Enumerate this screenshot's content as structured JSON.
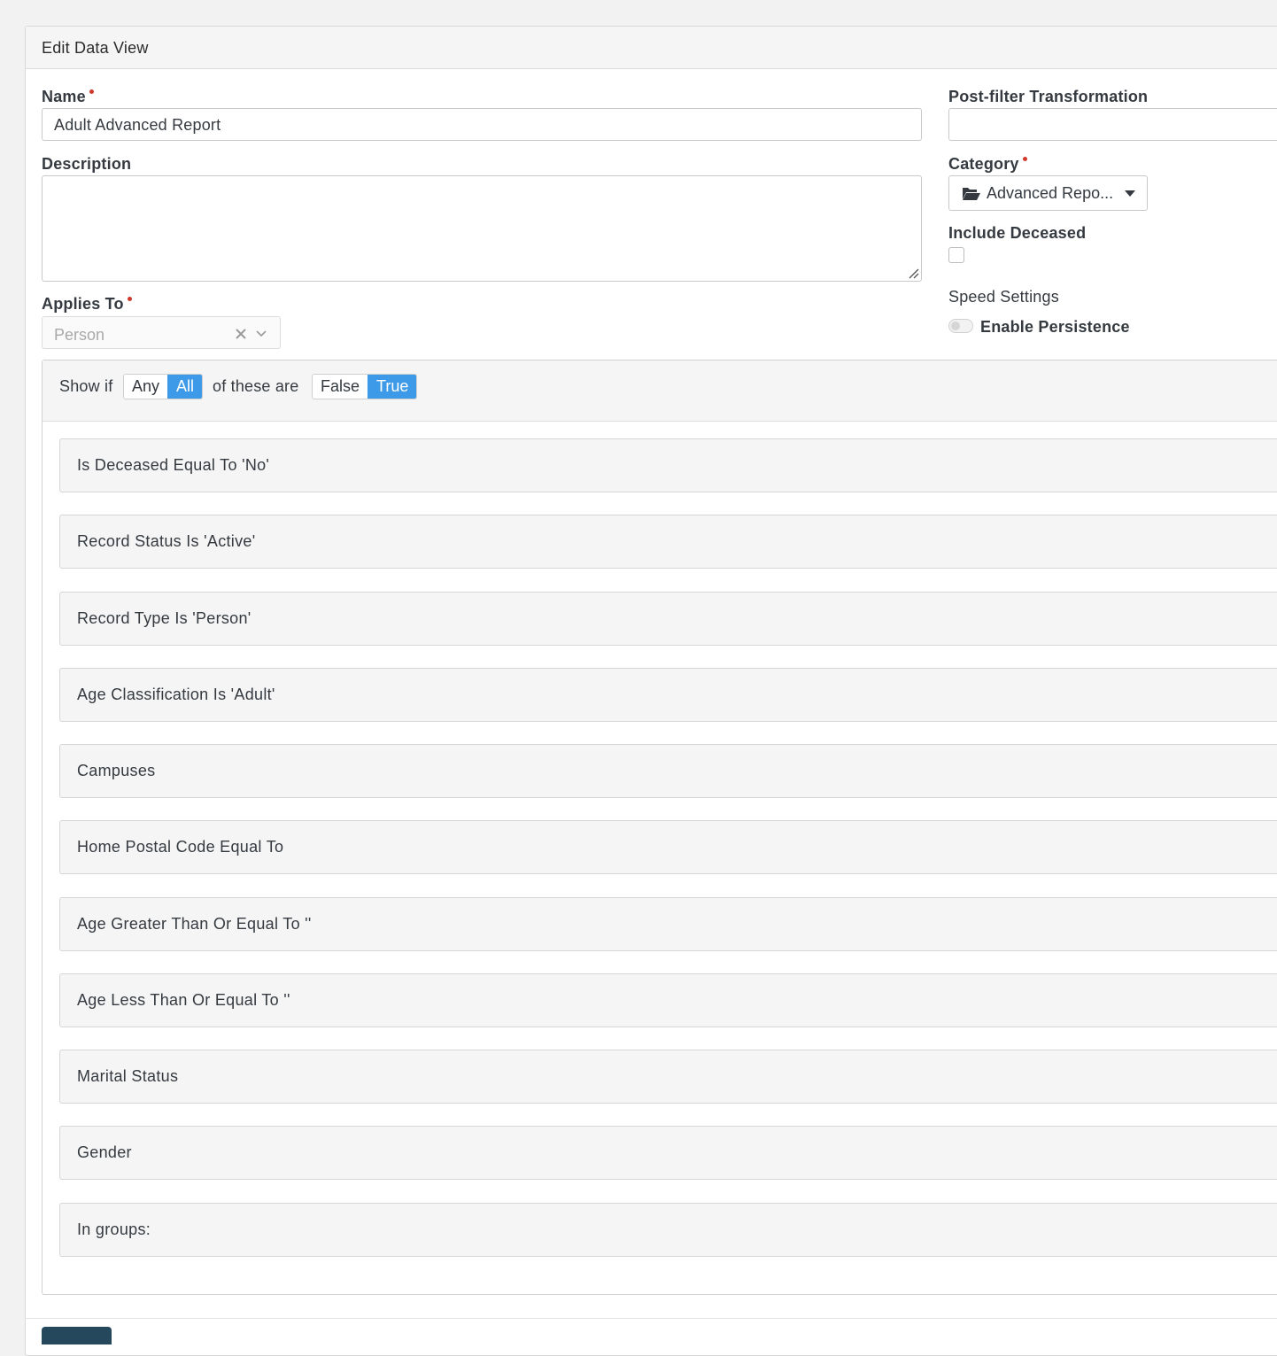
{
  "panel": {
    "title": "Edit Data View"
  },
  "form": {
    "name_label": "Name",
    "name_value": "Adult Advanced Report",
    "description_label": "Description",
    "description_value": "",
    "applies_to_label": "Applies To",
    "applies_to_value": "Person",
    "post_filter_label": "Post-filter Transformation",
    "post_filter_value": "",
    "category_label": "Category",
    "category_value": "Advanced Repo...",
    "include_deceased_label": "Include Deceased",
    "include_deceased_checked": false,
    "speed_settings_label": "Speed Settings",
    "enable_persistence_label": "Enable Persistence",
    "enable_persistence_on": false
  },
  "filter": {
    "show_if": "Show if",
    "any_label": "Any",
    "all_label": "All",
    "of_these_are": "of these are",
    "false_label": "False",
    "true_label": "True",
    "selected_match": "All",
    "selected_truth": "True",
    "accent_color": "#3d9ae8",
    "rules": [
      "Is Deceased Equal To 'No'",
      "Record Status Is 'Active'",
      "Record Type Is 'Person'",
      "Age Classification Is 'Adult'",
      "Campuses",
      "Home Postal Code Equal To",
      "Age Greater Than Or Equal To ''",
      "Age Less Than Or Equal To ''",
      "Marital Status",
      "Gender",
      "In groups:"
    ]
  },
  "icons": {
    "category": "folder-open-icon",
    "category_caret": "caret-down-icon",
    "clear": "clear-x-icon",
    "dropdown": "chevron-down-icon"
  }
}
